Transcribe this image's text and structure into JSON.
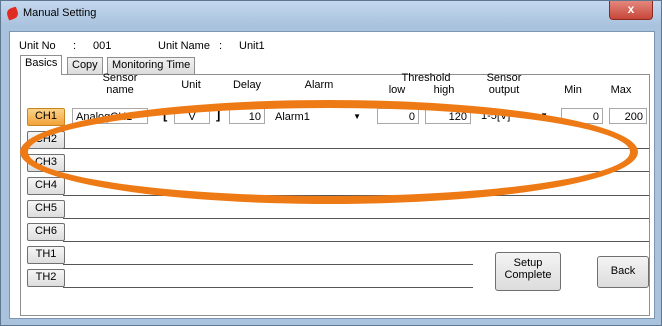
{
  "window": {
    "title": "Manual Setting",
    "close_label": "x"
  },
  "unit": {
    "no_label": "Unit No",
    "sep1": ":",
    "no_value": "001",
    "name_label": "Unit Name",
    "sep2": ":",
    "name_value": "Unit1"
  },
  "tabs": [
    {
      "label": "Basics"
    },
    {
      "label": "Copy"
    },
    {
      "label": "Monitoring Time"
    }
  ],
  "headers": {
    "sensor_line1": "Sensor",
    "sensor_line2": "name",
    "unit": "Unit",
    "delay": "Delay",
    "alarm": "Alarm",
    "threshold": "Threshold",
    "low": "low",
    "high": "high",
    "sensor_output_line1": "Sensor",
    "sensor_output_line2": "output",
    "min": "Min",
    "max": "Max"
  },
  "ch1": {
    "label": "CH1",
    "sensor_name": "AnalogCH1",
    "bracket_open": "[",
    "unit": "V",
    "bracket_close": "]",
    "delay": "10",
    "alarm": "Alarm1",
    "threshold_low": "0",
    "threshold_high": "120",
    "sensor_output": "1-5[V]",
    "min": "0",
    "max": "200"
  },
  "channels": [
    {
      "label": "CH2"
    },
    {
      "label": "CH3"
    },
    {
      "label": "CH4"
    },
    {
      "label": "CH5"
    },
    {
      "label": "CH6"
    },
    {
      "label": "TH1"
    },
    {
      "label": "TH2"
    }
  ],
  "buttons": {
    "setup_line1": "Setup",
    "setup_line2": "Complete",
    "back": "Back"
  },
  "colors": {
    "highlight": "#ee7a16",
    "active_channel": "#f2a23a"
  }
}
